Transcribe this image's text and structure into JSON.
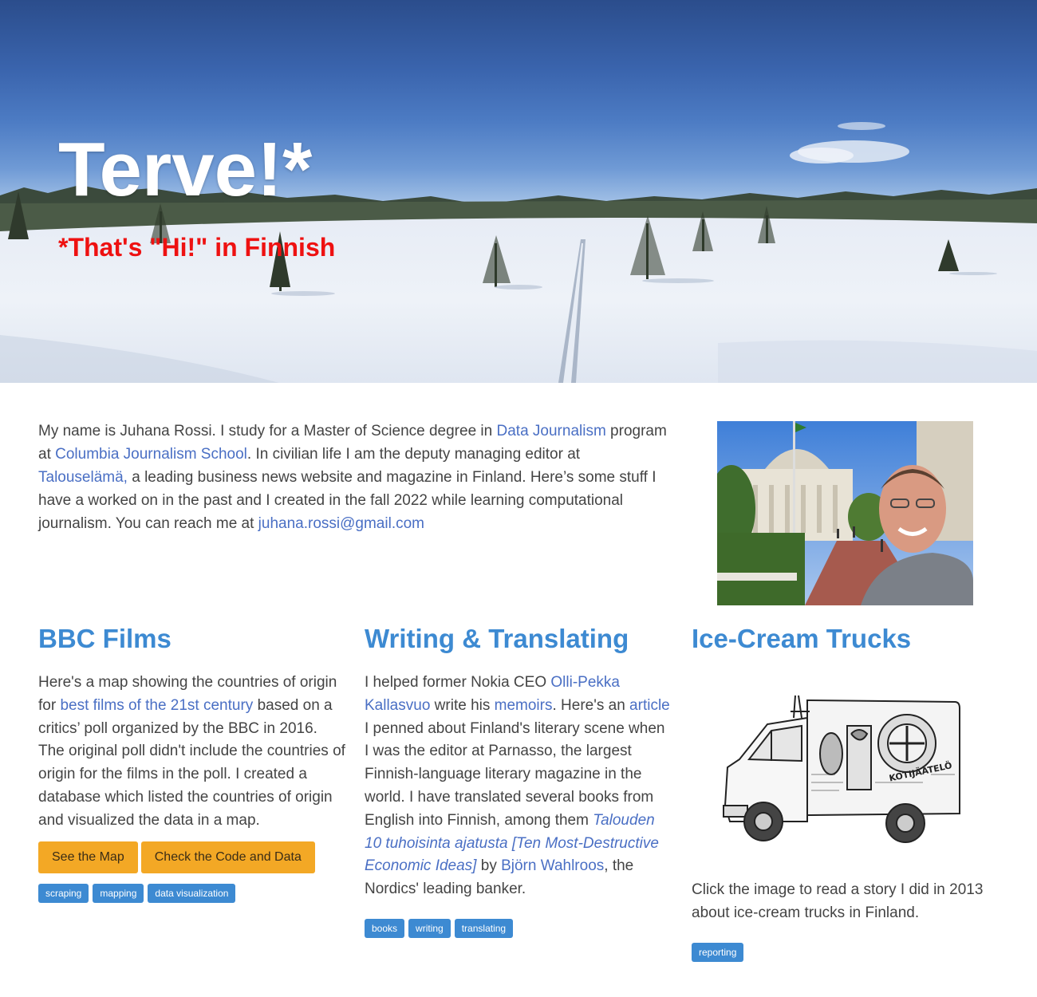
{
  "hero": {
    "title": "Terve!*",
    "subtitle": "*That's \"Hi!\" in Finnish"
  },
  "intro": {
    "t1": "My name is Juhana Rossi. I study for a Master of Science degree in ",
    "link1": "Data Journalism",
    "t2": " program at ",
    "link2": "Columbia Journalism School",
    "t3": ". In civilian life I am the deputy managing editor at ",
    "link3": "Talouselämä,",
    "t4": " a leading business news website and magazine in Finland. Here’s some stuff I have a worked on in the past and I created in the fall 2022 while learning computational journalism. You can reach me at ",
    "email": "juhana.rossi@gmail.com"
  },
  "projects": {
    "bbc": {
      "title": "BBC Films",
      "t1": "Here's a map showing the countries of origin for ",
      "link1": "best films of the 21st century",
      "t2": " based on a critics’ poll organized by the BBC in 2016. The original poll didn't include the countries of origin for the films in the poll. I created a database which listed the countries of origin and visualized the data in a map.",
      "btn1": "See the Map",
      "btn2": "Check the Code and Data",
      "tags": [
        "scraping",
        "mapping",
        "data visualization"
      ]
    },
    "writing": {
      "title": "Writing & Translating",
      "t1": "I helped former Nokia CEO ",
      "link1": "Olli-Pekka Kallasvuo",
      "t2": " write his ",
      "link2": "memoirs",
      "t3": ". Here's an ",
      "link3": "article",
      "t4": " I penned about Finland's literary scene when I was the editor at Parnasso, the largest Finnish-language literary magazine in the world. I have translated several books from English into Finnish, among them ",
      "link4": "Talouden 10 tuhoisinta ajatusta [Ten Most-Destructive Economic Ideas]",
      "t5": " by ",
      "link5": "Björn Wahlroos",
      "t6": ", the Nordics' leading banker.",
      "tags": [
        "books",
        "writing",
        "translating"
      ]
    },
    "icecream": {
      "title": "Ice-Cream Trucks",
      "text": "Click the image to read a story I did in 2013 about ice-cream trucks in Finland.",
      "tags": [
        "reporting"
      ],
      "truck_sign": "KOTIJÄÄTELÖ"
    }
  },
  "colors": {
    "heading": "#3d8ad2",
    "link": "#4a6fc4",
    "button": "#f3a825",
    "tag": "#3d8ad2",
    "subtitle": "#ee1111"
  }
}
